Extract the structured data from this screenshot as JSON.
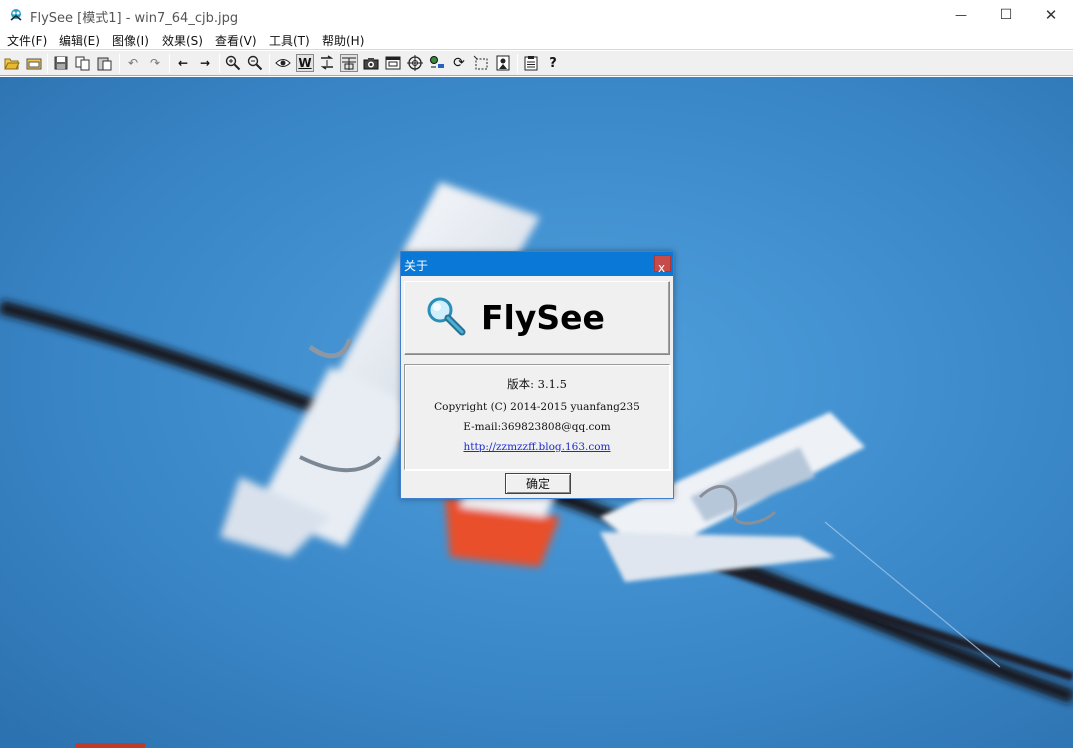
{
  "window": {
    "title": "FlySee [模式1] - win7_64_cjb.jpg",
    "minimize_glyph": "—",
    "maximize_glyph": "☐",
    "close_glyph": "✕"
  },
  "menu": [
    "文件(F)",
    "编辑(E)",
    "图像(I)",
    "效果(S)",
    "查看(V)",
    "工具(T)",
    "帮助(H)"
  ],
  "toolbar": {
    "icons": [
      "open-folder-icon",
      "open-file-icon",
      "save-icon",
      "copy-icon",
      "paste-icon",
      "undo-icon",
      "redo-icon",
      "previous-icon",
      "next-icon",
      "zoom-in-icon",
      "zoom-out-icon",
      "eye-icon",
      "fit-width-icon",
      "flip-icon",
      "fit-icon",
      "camera-icon",
      "window-icon",
      "target-icon",
      "slideshow-icon",
      "rotate-icon",
      "select-icon",
      "image-icon",
      "properties-icon",
      "help-icon"
    ],
    "glyphs": {
      "help": "?",
      "previous": "←",
      "next": "→",
      "fit_width": "W",
      "undo": "↶",
      "redo": "↷",
      "rotate": "⟳"
    }
  },
  "about_dialog": {
    "title": "关于",
    "close_label": "x",
    "brand": "FlySee",
    "version": "版本: 3.1.5",
    "copyright": "Copyright (C) 2014-2015 yuanfang235",
    "email": "E-mail:369823808@qq.com",
    "link": "http://zzmzzff.blog.163.com",
    "ok_label": "确定"
  },
  "colors": {
    "titlebar_active": "#0a78d7",
    "sky": "#3b86c6",
    "link": "#1a2ccc"
  }
}
